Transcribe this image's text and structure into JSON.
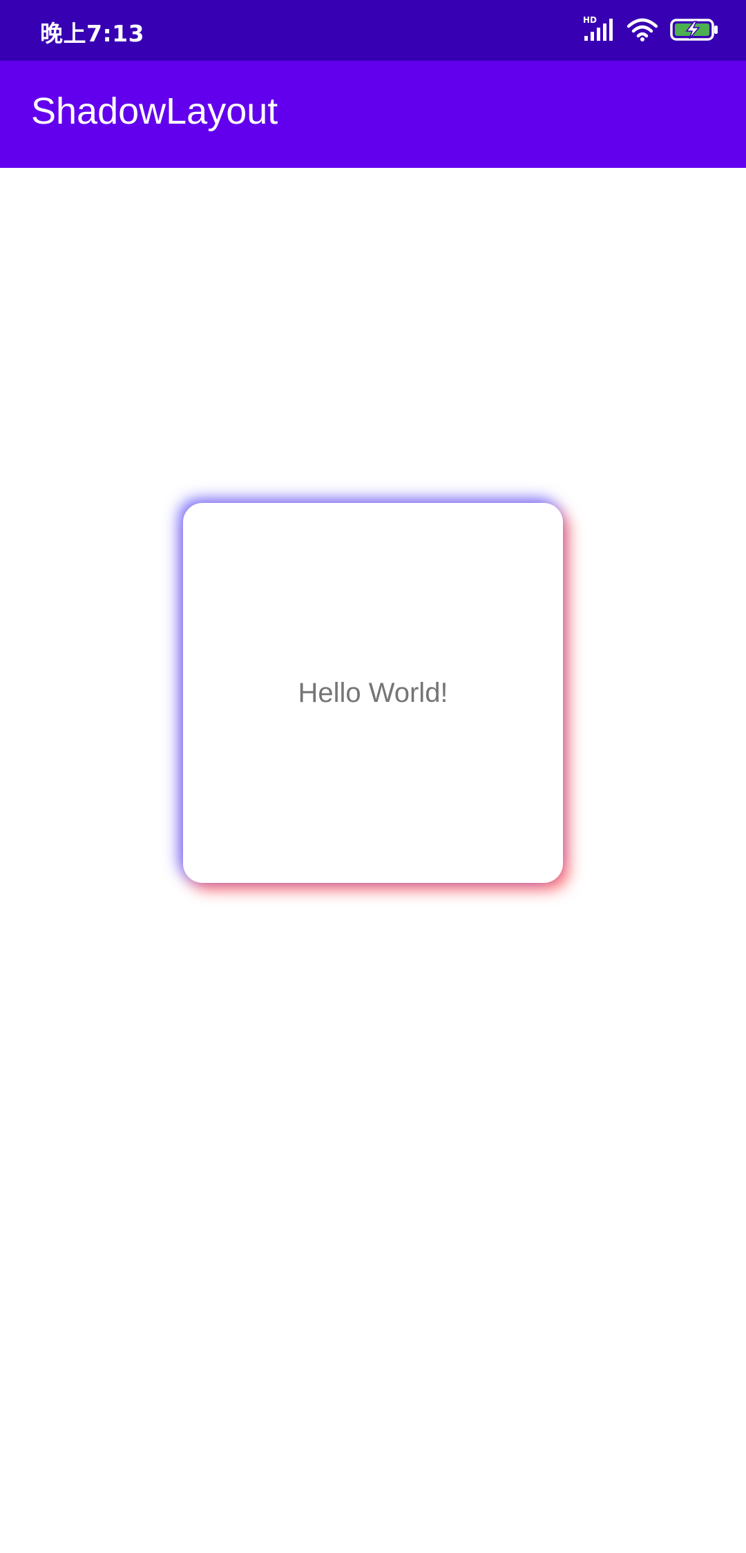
{
  "status_bar": {
    "time": "晚上7:13",
    "network_label": "HD",
    "icons": [
      "signal-icon",
      "wifi-icon",
      "battery-charging-icon"
    ],
    "background": "#3700b3"
  },
  "app_bar": {
    "title": "ShadowLayout",
    "background": "#6200ee"
  },
  "card": {
    "text": "Hello World!",
    "shadow_top_left_color": "#4a3cff",
    "shadow_bottom_right_color": "#ff4a4a"
  }
}
